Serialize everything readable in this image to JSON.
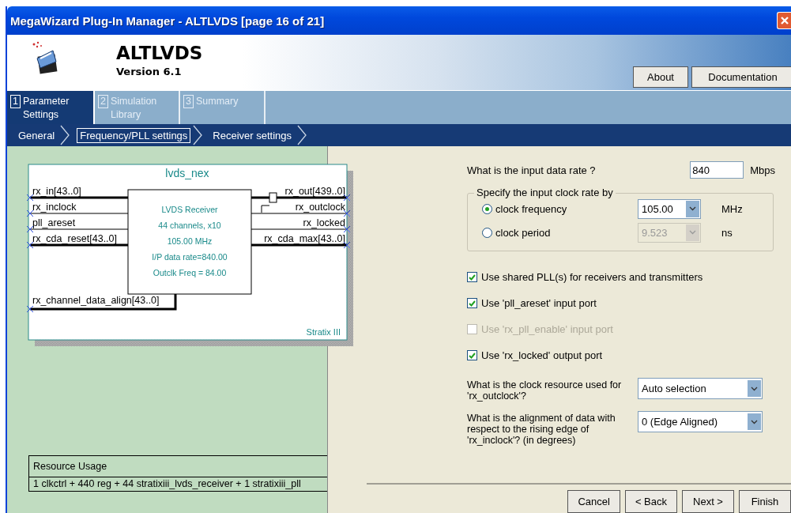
{
  "window": {
    "title": "MegaWizard Plug-In Manager - ALTLVDS [page 16 of 21]"
  },
  "header": {
    "title": "ALTLVDS",
    "version": "Version 6.1",
    "buttons": [
      "About",
      "Documentation"
    ]
  },
  "tabs": [
    {
      "number": "1",
      "label": "Parameter Settings",
      "selected": true
    },
    {
      "number": "2",
      "label": "Simulation Library",
      "selected": false
    },
    {
      "number": "3",
      "label": "Summary",
      "selected": false
    }
  ],
  "steps": [
    {
      "label": "General",
      "selected": false
    },
    {
      "label": "Frequency/PLL settings",
      "selected": true
    },
    {
      "label": "Receiver settings",
      "selected": false
    }
  ],
  "diagram": {
    "name": "lvds_nex",
    "ports_left": [
      {
        "label": "rx_in[43..0]",
        "bus": true
      },
      {
        "label": "rx_inclock",
        "bus": false
      },
      {
        "label": "pll_areset",
        "bus": false
      },
      {
        "label": "rx_cda_reset[43..0]",
        "bus": true
      }
    ],
    "ports_right": [
      {
        "label": "rx_out[439..0]",
        "bus": true
      },
      {
        "label": "rx_outclock",
        "bus": false
      },
      {
        "label": "rx_locked",
        "bus": false
      },
      {
        "label": "rx_cda_max[43..0]",
        "bus": true
      }
    ],
    "bottom_port": {
      "label": "rx_channel_data_align[43..0]",
      "bus": true
    },
    "block_lines": [
      "LVDS Receiver",
      "44 channels, x10",
      "105.00 MHz",
      "I/P data rate=840.00",
      "Outclk Freq = 84.00"
    ],
    "family": "Stratix III"
  },
  "resource_usage": {
    "heading": "Resource Usage",
    "text": "1 clkctrl + 440 reg + 44 stratixiii_lvds_receiver + 1 stratixiii_pll"
  },
  "form": {
    "data_rate": {
      "label": "What is the input data rate ?",
      "value": "840",
      "unit": "Mbps"
    },
    "clock_group": {
      "legend": "Specify the input clock rate by",
      "options": [
        {
          "label": "clock frequency",
          "selected": true,
          "value": "105.00",
          "unit": "MHz",
          "field_disabled": false
        },
        {
          "label": "clock period",
          "selected": false,
          "value": "9.523",
          "unit": "ns",
          "field_disabled": true
        }
      ]
    },
    "checkboxes": [
      {
        "label": "Use shared PLL(s) for receivers and transmitters",
        "checked": true,
        "disabled": false
      },
      {
        "label": "Use 'pll_areset' input port",
        "checked": true,
        "disabled": false
      },
      {
        "label": "Use 'rx_pll_enable' input port",
        "checked": false,
        "disabled": true
      },
      {
        "label": "Use 'rx_locked' output port",
        "checked": true,
        "disabled": false
      }
    ],
    "selects": [
      {
        "label": "What is the clock resource used for 'rx_outclock'?",
        "value": "Auto selection"
      },
      {
        "label": "What is the alignment of data with respect to the rising edge of 'rx_inclock'? (in degrees)",
        "value": "0 (Edge Aligned)"
      }
    ]
  },
  "footer_buttons": [
    "Cancel",
    "< Back",
    "Next >",
    "Finish"
  ]
}
